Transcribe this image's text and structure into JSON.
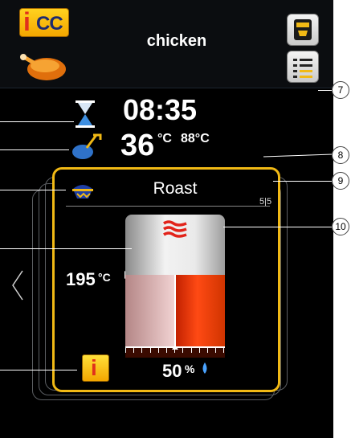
{
  "header": {
    "logo_text_i": "i",
    "logo_text_cc": "CC",
    "title": "chicken"
  },
  "status": {
    "time": "08:35",
    "core_temp": "36",
    "core_temp_unit": "°C",
    "cabinet_temp": "88°C"
  },
  "step": {
    "mode": "Roast",
    "step_counter": "5|5",
    "set_temperature": "195",
    "set_temperature_unit": "°C",
    "humidity": "50",
    "humidity_unit": "%"
  },
  "gauge": {
    "temperature_level": 0.5,
    "humidity_level": 0.5
  },
  "callouts": [
    "7",
    "8",
    "9",
    "10"
  ],
  "colors": {
    "accent": "#f1b915",
    "heat": "#ff4a14",
    "humidity": "#4aa3ff"
  },
  "icons": [
    "icc-logo",
    "chicken-icon",
    "cart-icon",
    "list-icon",
    "hourglass-icon",
    "core-probe-icon",
    "roast-mode-icon",
    "steam-icon",
    "water-drop-icon",
    "info-icon",
    "chevron-left-icon"
  ]
}
